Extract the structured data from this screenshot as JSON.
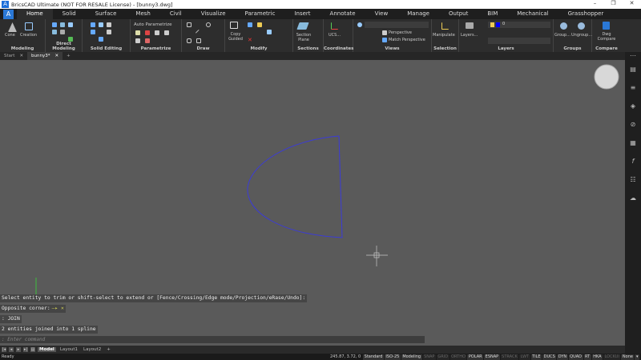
{
  "window": {
    "title": "BricsCAD Ultimate (NOT FOR RESALE License) - [bunny3.dwg]",
    "minimize": "–",
    "maximize": "❐",
    "close": "✕"
  },
  "menu": {
    "app_icon": "A",
    "tabs": [
      "Home",
      "Solid",
      "Surface",
      "Mesh",
      "Civil",
      "Visualize",
      "Parametric",
      "Insert",
      "Annotate",
      "View",
      "Manage",
      "Output",
      "BIM",
      "Mechanical",
      "Grasshopper"
    ],
    "active": "Home"
  },
  "ribbon": {
    "panels": [
      {
        "label": "Modeling",
        "buttons": [
          "Cone",
          "Creation"
        ]
      },
      {
        "label": "Direct Modeling"
      },
      {
        "label": "Solid Editing"
      },
      {
        "label": "Parametrize",
        "buttons": [
          "Auto Parametrize"
        ]
      },
      {
        "label": "Draw"
      },
      {
        "label": "Modify",
        "buttons": [
          "Copy Guided"
        ]
      },
      {
        "label": "Sections",
        "buttons": [
          "Section Plane"
        ]
      },
      {
        "label": "Coordinates",
        "buttons": [
          "UCS..."
        ]
      },
      {
        "label": "Views",
        "buttons": [
          "Perspective",
          "Match Perspective"
        ]
      },
      {
        "label": "Selection",
        "buttons": [
          "Manipulate"
        ]
      },
      {
        "label": "Layers",
        "buttons": [
          "Layers..."
        ],
        "layer_value": "0",
        "layer_color": "#0000ff"
      },
      {
        "label": "Groups",
        "buttons": [
          "Group...",
          "Ungroup..."
        ]
      },
      {
        "label": "Compare",
        "buttons": [
          "Dwg Compare"
        ]
      }
    ]
  },
  "doc_tabs": [
    {
      "label": "Start"
    },
    {
      "label": "bunny3*",
      "active": true
    }
  ],
  "doc_tab_close": "✕",
  "doc_tab_add": "+",
  "drawing": {
    "curve_color": "#3b3bd8",
    "crosshair_color": "#c8c8c8",
    "ucs_y_color": "#3fbf3f"
  },
  "command": {
    "history": [
      "Select entity to trim or shift-select to extend or [Fence/Crossing/Edge mode/Projection/eRase/Undo]:",
      "Opposite corner:",
      ": JOIN",
      "2 entities joined into 1 spline"
    ],
    "placeholder": ": Enter command"
  },
  "layout_tabs": [
    "Model",
    "Layout1",
    "Layout2",
    "+"
  ],
  "status": {
    "ready": "Ready",
    "coords": "245.87, 3.72, 0",
    "toggles": [
      {
        "label": "Standard",
        "on": true
      },
      {
        "label": "ISO-25",
        "on": true
      },
      {
        "label": "Modeling",
        "on": true
      },
      {
        "label": "SNAP",
        "on": false
      },
      {
        "label": "GRID",
        "on": false
      },
      {
        "label": "ORTHO",
        "on": false
      },
      {
        "label": "POLAR",
        "on": true
      },
      {
        "label": "ESNAP",
        "on": true
      },
      {
        "label": "STRACK",
        "on": false
      },
      {
        "label": "LWT",
        "on": false
      },
      {
        "label": "TILE",
        "on": true
      },
      {
        "label": "DUCS",
        "on": true
      },
      {
        "label": "DYN",
        "on": true
      },
      {
        "label": "QUAD",
        "on": true
      },
      {
        "label": "RT",
        "on": true
      },
      {
        "label": "HKA",
        "on": true
      },
      {
        "label": "LOCKUI",
        "on": false
      },
      {
        "label": "None",
        "on": true
      }
    ]
  },
  "right_toolbar": [
    "properties-icon",
    "settings-icon",
    "layers-icon",
    "attach-icon",
    "grid-icon",
    "fx-icon",
    "structure-icon",
    "cloud-icon"
  ]
}
